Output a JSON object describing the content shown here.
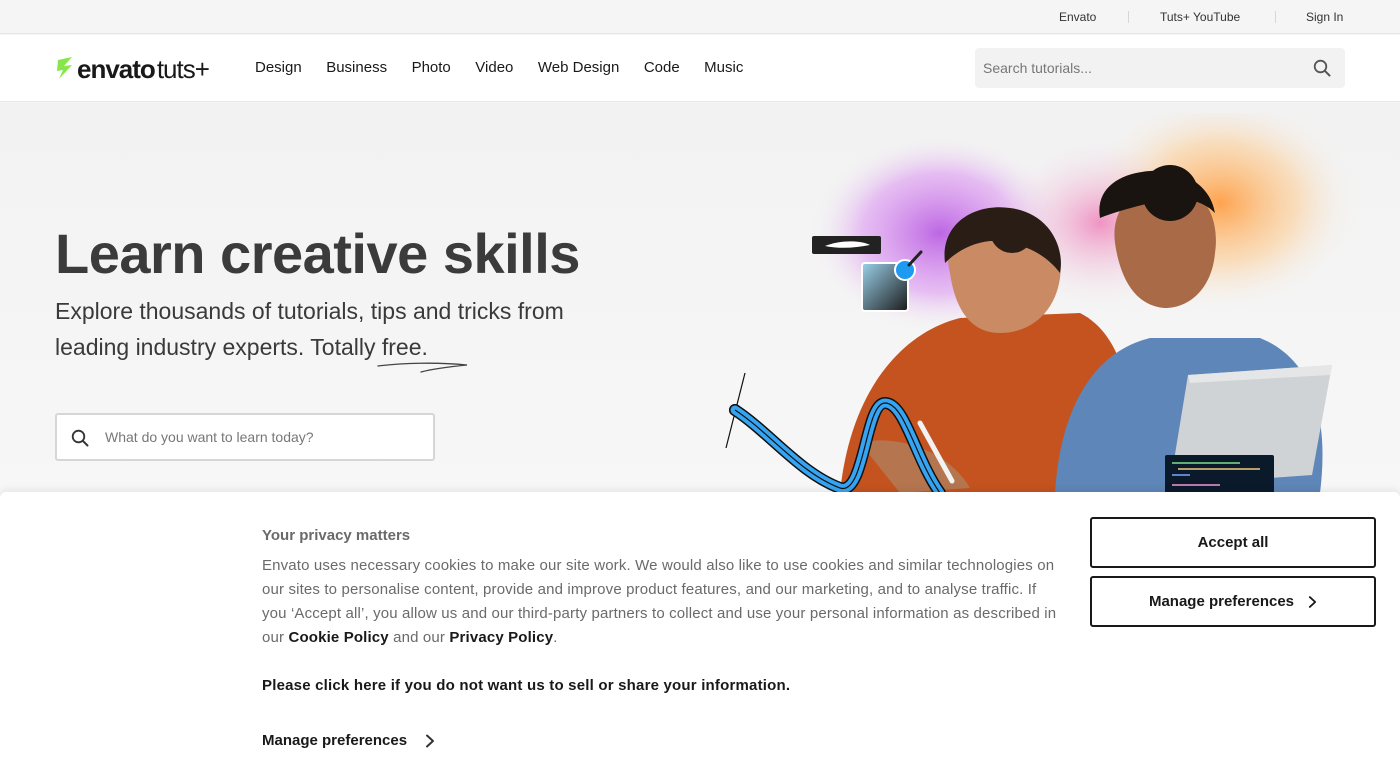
{
  "topbar": {
    "links": [
      "Envato",
      "Tuts+ YouTube",
      "Sign In"
    ]
  },
  "nav": {
    "logo_word": "envato",
    "logo_tuts": "tuts+",
    "items": [
      "Design",
      "Business",
      "Photo",
      "Video",
      "Web Design",
      "Code",
      "Music"
    ],
    "search_placeholder": "Search tutorials...",
    "search_icon": "search-icon"
  },
  "hero": {
    "title": "Learn creative skills",
    "subtitle": "Explore thousands of tutorials, tips and tricks from leading industry experts. Totally free.",
    "search_placeholder": "What do you want to learn today?"
  },
  "cookie": {
    "title": "Your privacy matters",
    "body_text": "Envato uses necessary cookies to make our site work. We would also like to use cookies and similar technologies on our sites to personalise content, provide and improve product features, and our marketing, and to analyse traffic. If you ‘Accept all’, you allow us and our third-party partners to collect and use your personal information as described in  our",
    "cookie_policy": "Cookie Policy",
    "and_our": "and our",
    "privacy_policy": "Privacy Policy",
    "period": ".",
    "optout": "Please click here if you do not want us to sell or share your information.",
    "manage_link": "Manage preferences",
    "accept_button": "Accept all",
    "manage_button": "Manage preferences"
  },
  "colors": {
    "brand_green": "#87e64b",
    "accent_blue": "#1e9af0",
    "text_dark": "#191919",
    "text_muted": "#6a6a6a"
  }
}
